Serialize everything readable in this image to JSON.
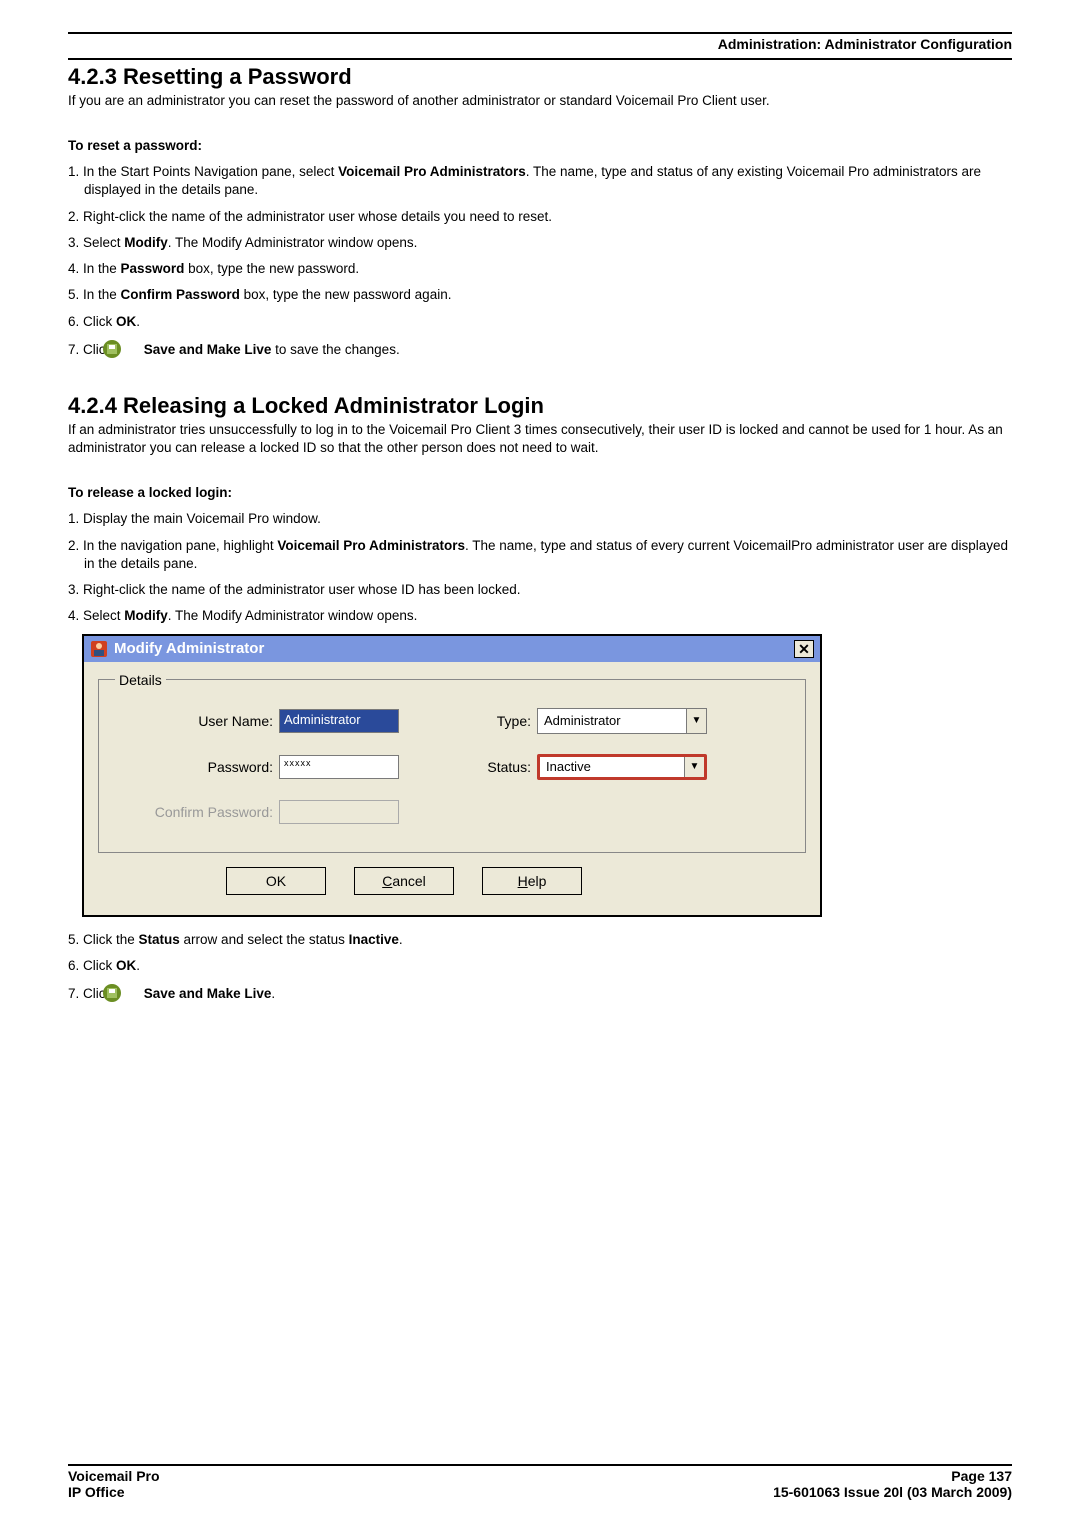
{
  "header": {
    "breadcrumb": "Administration: Administrator Configuration"
  },
  "section_423": {
    "title": "4.2.3 Resetting a Password",
    "intro": "If you are an administrator you can reset the password of another administrator or standard Voicemail Pro Client user.",
    "sub_heading": "To reset a password:",
    "steps": {
      "s1_prefix": "1. In the Start Points Navigation pane, select ",
      "s1_bold": "Voicemail Pro Administrators",
      "s1_suffix": ". The name, type and status of any existing Voicemail Pro administrators are displayed in the details pane.",
      "s2": "2. Right-click the name of the administrator user whose details you need to reset.",
      "s3_prefix": "3. Select ",
      "s3_bold": "Modify",
      "s3_suffix": ". The Modify Administrator window opens.",
      "s4_prefix": "4. In the ",
      "s4_bold": "Password",
      "s4_suffix": " box, type the new password.",
      "s5_prefix": "5. In the ",
      "s5_bold": "Confirm Password",
      "s5_suffix": " box, type the new password again.",
      "s6_prefix": "6. Click ",
      "s6_bold": "OK",
      "s6_suffix": ".",
      "s7_prefix": "7. Click ",
      "s7_bold": "Save and Make Live",
      "s7_suffix": " to save the changes."
    }
  },
  "section_424": {
    "title": "4.2.4 Releasing a Locked Administrator Login",
    "intro": "If an administrator tries unsuccessfully to log in to the Voicemail Pro Client 3 times consecutively, their user ID is locked and cannot be used for 1 hour. As an administrator you can release a locked ID so that the other person does not need to wait.",
    "sub_heading": "To release a locked login:",
    "steps": {
      "s1": "1. Display the main Voicemail Pro window.",
      "s2_prefix": "2. In the navigation pane, highlight ",
      "s2_bold": "Voicemail Pro Administrators",
      "s2_suffix": ". The name, type and status of every current VoicemailPro administrator user are displayed in the details pane.",
      "s3": "3. Right-click the name of the administrator user whose ID has been locked.",
      "s4_prefix": "4. Select ",
      "s4_bold": "Modify",
      "s4_suffix": ". The Modify Administrator window opens.",
      "s5_prefix": "5. Click the ",
      "s5_bold1": "Status",
      "s5_middle": " arrow and select the status ",
      "s5_bold2": "Inactive",
      "s5_suffix": ".",
      "s6_prefix": "6. Click ",
      "s6_bold": "OK",
      "s6_suffix": ".",
      "s7_prefix": "7. Click ",
      "s7_bold": "Save and Make Live",
      "s7_suffix": "."
    }
  },
  "dialog": {
    "title": "Modify Administrator",
    "legend": "Details",
    "username_label": "User Name:",
    "username_value": "Administrator",
    "type_label": "Type:",
    "type_value": "Administrator",
    "password_label": "Password:",
    "password_value": "xxxxx",
    "status_label": "Status:",
    "status_value": "Inactive",
    "confirm_label": "Confirm Password:",
    "ok_btn": "OK",
    "cancel_btn_u": "C",
    "cancel_btn_rest": "ancel",
    "help_btn_u": "H",
    "help_btn_rest": "elp"
  },
  "footer": {
    "left1": "Voicemail Pro",
    "left2": "IP Office",
    "right1": "Page 137",
    "right2": "15-601063 Issue 20l (03 March 2009)"
  }
}
